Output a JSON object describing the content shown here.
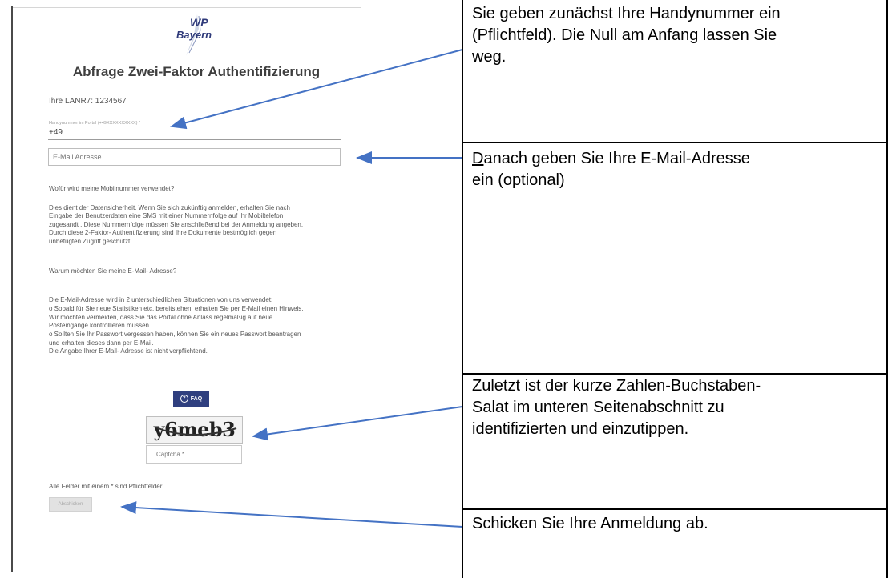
{
  "form": {
    "logo": {
      "line1": "WP",
      "line2": "Bayern"
    },
    "title": "Abfrage Zwei-Faktor Authentifizierung",
    "lanr": "Ihre LANR7: 1234567",
    "phone": {
      "label": "Handynummer im Portal (+49XXXXXXXXXX) *",
      "value": "+49"
    },
    "email_placeholder": "E-Mail Adresse",
    "mobile_question": "Wofür wird meine Mobilnummer verwendet?",
    "mobile_answer": [
      "Dies dient der Datensicherheit. Wenn Sie sich zukünftig anmelden, erhalten Sie nach",
      "Eingabe der Benutzerdaten eine SMS mit einer Nummernfolge auf Ihr Mobiltelefon",
      "zugesandt . Diese Nummernfolge müssen Sie anschließend bei der Anmeldung angeben.",
      "Durch diese 2-Faktor- Authentifizierung sind Ihre Dokumente bestmöglich gegen",
      "unbefugten Zugriff geschützt."
    ],
    "email_question": "Warum möchten Sie meine E-Mail- Adresse?",
    "email_answer": [
      "Die E-Mail-Adresse wird in 2 unterschiedlichen Situationen von uns verwendet:",
      "o Sobald für Sie neue Statistiken etc. bereitstehen, erhalten Sie per E-Mail einen Hinweis.",
      "Wir möchten vermeiden, dass Sie das Portal ohne Anlass regelmäßig auf neue",
      "Posteingänge kontrollieren müssen.",
      "o Sollten Sie Ihr Passwort vergessen haben, können Sie ein neues Passwort beantragen",
      "und erhalten dieses dann per E-Mail.",
      "Die Angabe Ihrer E-Mail- Adresse ist nicht verpflichtend."
    ],
    "faq_label": "FAQ",
    "faq_icon": "question-circle-icon",
    "captcha_text": "y6meb3",
    "captcha_placeholder": "Captcha *",
    "required_note": "Alle Felder mit einem * sind Pflichtfelder.",
    "submit_label": "Abschicken"
  },
  "annotations": {
    "phone": [
      "Sie geben zunächst Ihre Handynummer ein",
      "(Pflichtfeld). Die Null am Anfang lassen Sie",
      "weg."
    ],
    "email_first_letter": "D",
    "email_rest_first_line": "anach geben Sie Ihre E-Mail-Adresse",
    "email_second_line": "ein (optional)",
    "captcha": [
      "Zuletzt ist der kurze Zahlen-Buchstaben-",
      "Salat im unteren Seitenabschnitt zu",
      "identifizierten und einzutippen."
    ],
    "submit": "Schicken Sie Ihre Anmeldung ab."
  },
  "colors": {
    "arrow": "#4472c4",
    "faq_button": "#2f3f7f",
    "title": "#3e3e3e"
  }
}
